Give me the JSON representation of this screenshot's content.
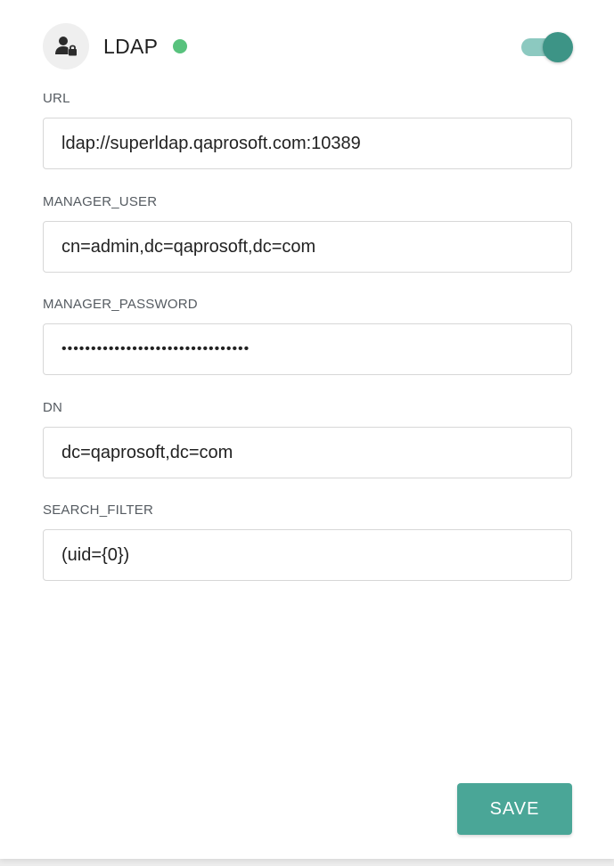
{
  "header": {
    "title": "LDAP",
    "status_color": "#58c27d",
    "status": "active",
    "icon": "user-lock-icon",
    "enabled": true
  },
  "fields": [
    {
      "label": "URL",
      "value": "ldap://superldap.qaprosoft.com:10389"
    },
    {
      "label": "MANAGER_USER",
      "value": "cn=admin,dc=qaprosoft,dc=com"
    },
    {
      "label": "MANAGER_PASSWORD",
      "value": "••••••••••••••••••••••••••••••••"
    },
    {
      "label": "DN",
      "value": "dc=qaprosoft,dc=com"
    },
    {
      "label": "SEARCH_FILTER",
      "value": "(uid={0})"
    }
  ],
  "actions": {
    "save_label": "SAVE"
  },
  "colors": {
    "accent": "#4aa697",
    "toggle_knob": "#3d9486",
    "toggle_track": "#8cc9c0"
  }
}
